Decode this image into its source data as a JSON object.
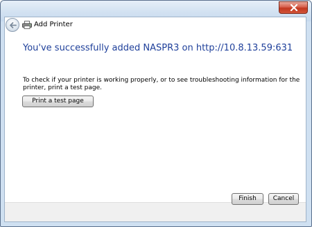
{
  "window": {
    "title": "Add Printer",
    "close_icon": "close-icon",
    "back_icon": "back-arrow-icon",
    "printer_icon": "printer-icon"
  },
  "content": {
    "heading": "You've successfully added NASPR3 on http://10.8.13.59:631",
    "description": "To check if your printer is working properly, or to see troubleshooting information for the printer, print a test page.",
    "test_page_button": "Print a test page"
  },
  "footer": {
    "finish_button": "Finish",
    "cancel_button": "Cancel"
  },
  "colors": {
    "heading": "#1e3f9a",
    "close_button": "#c2381f",
    "frame": "#cfe0f1"
  }
}
